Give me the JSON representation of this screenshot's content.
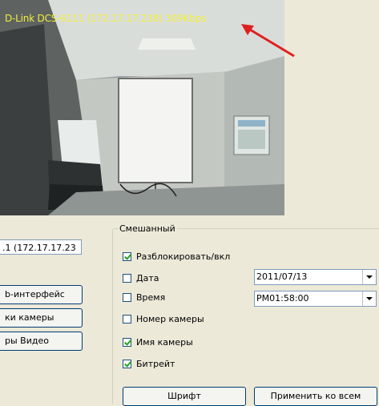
{
  "video": {
    "overlay": "D-Link DCS-6111 (172.17.17.238) 309Kbps"
  },
  "left_panel": {
    "address_value": ".1 (172.17.17.23",
    "buttons": [
      "b-интерфейс",
      "ки камеры",
      "ры Видео"
    ]
  },
  "group": {
    "legend": "Смешанный",
    "options": [
      {
        "label": "Разблокировать/вкл",
        "checked": true
      },
      {
        "label": "Дата",
        "checked": false
      },
      {
        "label": "Время",
        "checked": false
      },
      {
        "label": "Номер камеры",
        "checked": false
      },
      {
        "label": "Имя камеры",
        "checked": true
      },
      {
        "label": "Битрейт",
        "checked": true
      }
    ],
    "date_value": "2011/07/13",
    "time_value": "PM01:58:00",
    "font_button": "Шрифт",
    "apply_all_button": "Применить ко всем"
  },
  "colors": {
    "overlay_text": "#f3ef3a",
    "arrow": "#e02020"
  }
}
